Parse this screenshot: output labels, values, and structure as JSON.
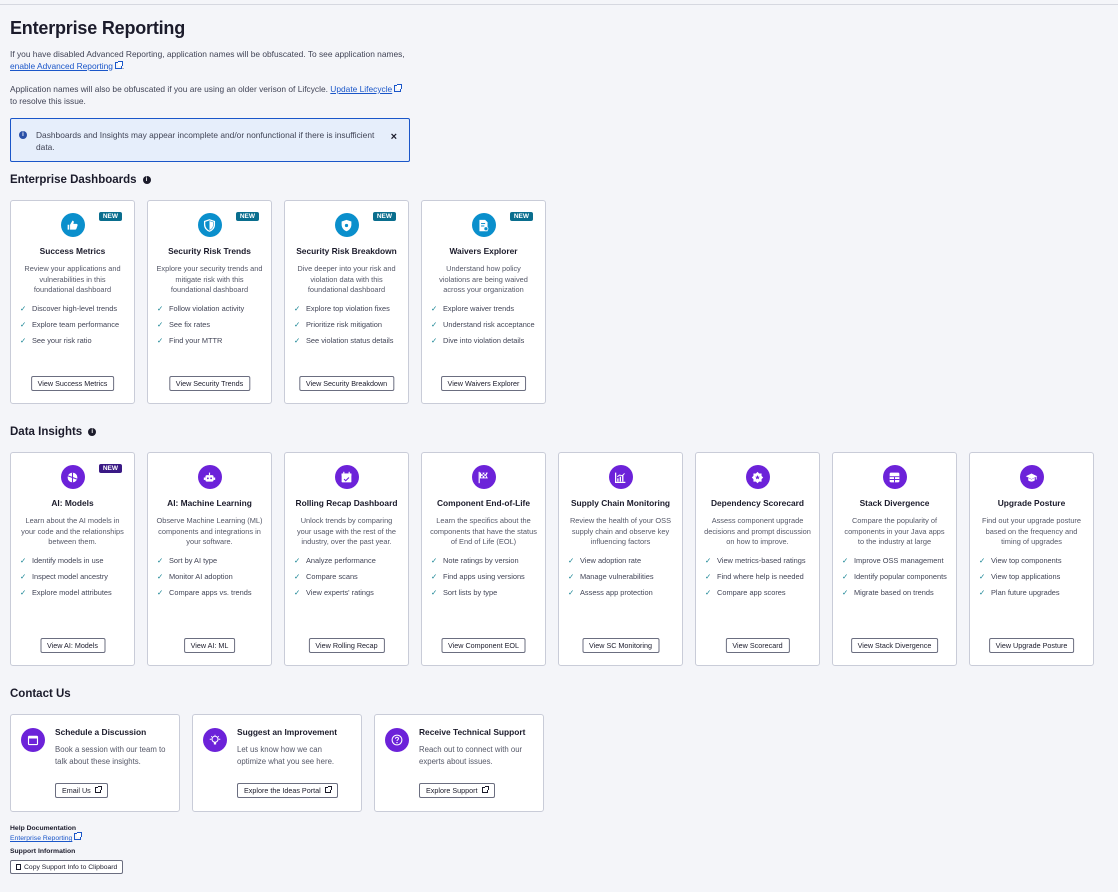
{
  "title": "Enterprise Reporting",
  "intro": {
    "p1_text": "If you have disabled Advanced Reporting, application names will be obfuscated. To see application names,",
    "p1_link": "enable Advanced Reporting",
    "p1_end": ".",
    "p2_text": "Application names will also be obfuscated if you are using an older verison of Lifcycle.",
    "p2_link": "Update Lifecycle",
    "p2_end": "to resolve this issue."
  },
  "alert": {
    "text": "Dashboards and Insights may appear incomplete and/or nonfunctional if there is insufficient data.",
    "close": "×"
  },
  "dashboards": {
    "heading": "Enterprise Dashboards",
    "cards": [
      {
        "icon": "thumbs-up-icon",
        "badge": "NEW",
        "title": "Success Metrics",
        "desc": "Review your applications and vulnerabilities in this foundational dashboard",
        "items": [
          "Discover high-level trends",
          "Explore team performance",
          "See your risk ratio"
        ],
        "button": "View Success Metrics"
      },
      {
        "icon": "shield-half-icon",
        "badge": "NEW",
        "title": "Security Risk Trends",
        "desc": "Explore your security trends and mitigate risk with this foundational dashboard",
        "items": [
          "Follow violation activity",
          "See fix rates",
          "Find your MTTR"
        ],
        "button": "View Security Trends"
      },
      {
        "icon": "shield-gear-icon",
        "badge": "NEW",
        "title": "Security Risk Breakdown",
        "desc": "Dive deeper into your risk and violation data with this foundational dashboard",
        "items": [
          "Explore top violation fixes",
          "Prioritize risk mitigation",
          "See violation status details"
        ],
        "button": "View Security Breakdown"
      },
      {
        "icon": "document-check-icon",
        "badge": "NEW",
        "title": "Waivers Explorer",
        "desc": "Understand how policy violations are being waived across your organization",
        "items": [
          "Explore waiver trends",
          "Understand risk acceptance",
          "Dive into violation details"
        ],
        "button": "View Waivers Explorer"
      }
    ]
  },
  "insights": {
    "heading": "Data Insights",
    "cards": [
      {
        "icon": "ai-models-icon",
        "badge": "NEW",
        "title": "AI: Models",
        "desc": "Learn about the AI models in your code and the relationships between them.",
        "items": [
          "Identify models in use",
          "Inspect model ancestry",
          "Explore model attributes"
        ],
        "button": "View AI: Models"
      },
      {
        "icon": "robot-icon",
        "title": "AI: Machine Learning",
        "desc": "Observe Machine Learning (ML) components and integrations in your software.",
        "items": [
          "Sort by AI type",
          "Monitor AI adoption",
          "Compare apps vs. trends"
        ],
        "button": "View AI: ML"
      },
      {
        "icon": "calendar-check-icon",
        "title": "Rolling Recap Dashboard",
        "desc": "Unlock trends by comparing your usage with the rest of the industry, over the past year.",
        "items": [
          "Analyze performance",
          "Compare scans",
          "View experts' ratings"
        ],
        "button": "View Rolling Recap"
      },
      {
        "icon": "flag-checkered-icon",
        "title": "Component End-of-Life",
        "desc": "Learn the specifics about the components that have the status of End of Life (EOL)",
        "items": [
          "Note ratings by version",
          "Find apps using versions",
          "Sort lists by type"
        ],
        "button": "View Component EOL"
      },
      {
        "icon": "chart-line-icon",
        "title": "Supply Chain Monitoring",
        "desc": "Review the health of your OSS supply chain and observe key influencing factors",
        "items": [
          "View adoption rate",
          "Manage vulnerabilities",
          "Assess app protection"
        ],
        "button": "View SC Monitoring"
      },
      {
        "icon": "star-badge-icon",
        "title": "Dependency Scorecard",
        "desc": "Assess component upgrade decisions and prompt discussion on how to improve.",
        "items": [
          "View metrics-based ratings",
          "Find where help is needed",
          "Compare app scores"
        ],
        "button": "View Scorecard"
      },
      {
        "icon": "grid-table-icon",
        "title": "Stack Divergence",
        "desc": "Compare the popularity of components in your Java apps to the industry at large",
        "items": [
          "Improve OSS management",
          "Identify popular components",
          "Migrate based on trends"
        ],
        "button": "View Stack Divergence"
      },
      {
        "icon": "graduation-cap-icon",
        "title": "Upgrade Posture",
        "desc": "Find out your upgrade posture based on the frequency and timing of upgrades",
        "items": [
          "View top components",
          "View top applications",
          "Plan future upgrades"
        ],
        "button": "View Upgrade Posture"
      }
    ]
  },
  "contact": {
    "heading": "Contact Us",
    "cards": [
      {
        "icon": "calendar-icon",
        "title": "Schedule a Discussion",
        "desc": "Book a session with our team to talk about these insights.",
        "button": "Email Us"
      },
      {
        "icon": "lightbulb-icon",
        "title": "Suggest an Improvement",
        "desc": "Let us know how we can optimize what you see here.",
        "button": "Explore the Ideas Portal"
      },
      {
        "icon": "question-circle-icon",
        "title": "Receive Technical Support",
        "desc": "Reach out to connect with our experts about issues.",
        "button": "Explore Support"
      }
    ]
  },
  "footer": {
    "help_heading": "Help Documentation",
    "help_link": "Enterprise Reporting",
    "support_heading": "Support Information",
    "copy_button": "Copy Support Info to Clipboard"
  },
  "colors": {
    "dashboard_icon": "#0a8fcc",
    "insight_icon": "#6c22d9",
    "link": "#1a56c9"
  }
}
